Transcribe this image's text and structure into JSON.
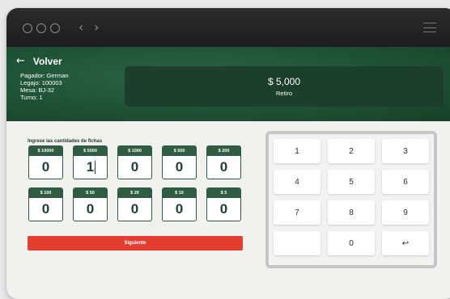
{
  "nav": {
    "back_icon": "←",
    "prev_icon": "‹",
    "next_icon": "›"
  },
  "header": {
    "back_label": "Volver",
    "info_lines": [
      "Pagador: German",
      "Legajo: 100003",
      "Mesa: BJ-32",
      "Turno: 1"
    ],
    "amount": "$ 5,000",
    "amount_type": "Retiro"
  },
  "chips": {
    "title": "Ingrese las cantidades de fichas",
    "items": [
      {
        "label": "$ 10000",
        "value": "0"
      },
      {
        "label": "$ 5000",
        "value": "1"
      },
      {
        "label": "$ 1000",
        "value": "0"
      },
      {
        "label": "$ 500",
        "value": "0"
      },
      {
        "label": "$ 200",
        "value": "0"
      },
      {
        "label": "$ 100",
        "value": "0"
      },
      {
        "label": "$ 50",
        "value": "0"
      },
      {
        "label": "$ 20",
        "value": "0"
      },
      {
        "label": "$ 10",
        "value": "0"
      },
      {
        "label": "$ 5",
        "value": "0"
      }
    ]
  },
  "next_label": "Siguiente",
  "keypad": {
    "keys": [
      "1",
      "2",
      "3",
      "4",
      "5",
      "6",
      "7",
      "8",
      "9",
      "",
      "0",
      "↩"
    ]
  },
  "colors": {
    "header_green": "#1e5034",
    "chip_label_green": "#2f5c42",
    "button_red": "#e23f30"
  }
}
